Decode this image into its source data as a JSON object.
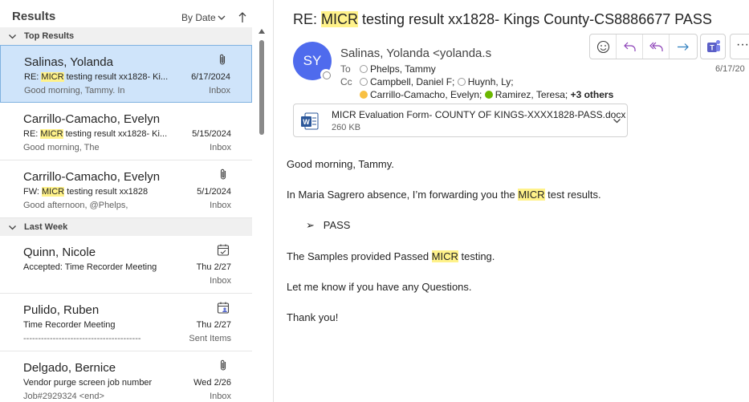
{
  "list": {
    "title": "Results",
    "sort_label": "By Date",
    "groups": [
      {
        "label": "Top Results"
      },
      {
        "label": "Last Week"
      }
    ],
    "mails": [
      {
        "sender": "Salinas, Yolanda",
        "subject_pre": "RE: ",
        "subject_hl": "MICR",
        "subject_post": " testing result xx1828- Ki...",
        "preview": "Good morning, Tammy.  In",
        "date": "6/17/2024",
        "folder": "Inbox",
        "icon": "paperclip-icon"
      },
      {
        "sender": "Carrillo-Camacho, Evelyn",
        "subject_pre": "RE: ",
        "subject_hl": "MICR",
        "subject_post": " testing result xx1828- Ki...",
        "preview": "Good morning,  The",
        "date": "5/15/2024",
        "folder": "Inbox",
        "icon": ""
      },
      {
        "sender": "Carrillo-Camacho, Evelyn",
        "subject_pre": "FW: ",
        "subject_hl": "MICR",
        "subject_post": " testing result xx1828",
        "preview": "Good afternoon,  @Phelps,",
        "date": "5/1/2024",
        "folder": "Inbox",
        "icon": "paperclip-icon"
      },
      {
        "sender": "Quinn, Nicole",
        "subject": "Accepted: Time Recorder Meeting",
        "preview": "",
        "date": "Thu 2/27",
        "folder": "Inbox",
        "icon": "calendar-accepted-icon"
      },
      {
        "sender": "Pulido, Ruben",
        "subject": "Time Recorder Meeting",
        "preview": "----------------------------------------",
        "date": "Thu 2/27",
        "folder": "Sent Items",
        "icon": "calendar-attendees-icon"
      },
      {
        "sender": "Delgado, Bernice",
        "subject": "Vendor purge screen  job number",
        "preview": "Job#2929324 <end>",
        "date": "Wed 2/26",
        "folder": "Inbox",
        "icon": "paperclip-icon"
      }
    ]
  },
  "reading": {
    "subject_pre": "RE: ",
    "subject_hl": "MICR",
    "subject_post": " testing result xx1828- Kings County-CS8886677 PASS",
    "avatar_initials": "SY",
    "avatar_color": "#4f6bed",
    "from": "Salinas, Yolanda <yolanda.sa",
    "to_label": "To",
    "to_name": "Phelps, Tammy",
    "cc_label": "Cc",
    "cc1": "Campbell, Daniel F;",
    "cc2": "Huynh, Ly;",
    "cc3": "Carrillo-Camacho, Evelyn;",
    "cc4": "Ramirez, Teresa;",
    "cc_more": "+3 others",
    "date": "6/17/20",
    "attachment": {
      "name": "MICR Evaluation Form- COUNTY OF KINGS-XXXX1828-PASS.docx",
      "size": "260 KB"
    },
    "body": {
      "greeting": "Good morning, Tammy.",
      "line1_pre": "In Maria Sagrero absence, I’m forwarding you the ",
      "line1_hl": "MICR",
      "line1_post": " test results.",
      "bullet_mark": "➢",
      "bullet": "PASS",
      "line2_pre": "The Samples provided Passed ",
      "line2_hl": "MICR",
      "line2_post": " testing.",
      "line3": "Let me know if you have any Questions.",
      "closing": "Thank you!"
    }
  },
  "colors": {
    "highlight": "#fff28a",
    "selected_row": "#cfe4fa",
    "accent": "#5c6ed0"
  }
}
